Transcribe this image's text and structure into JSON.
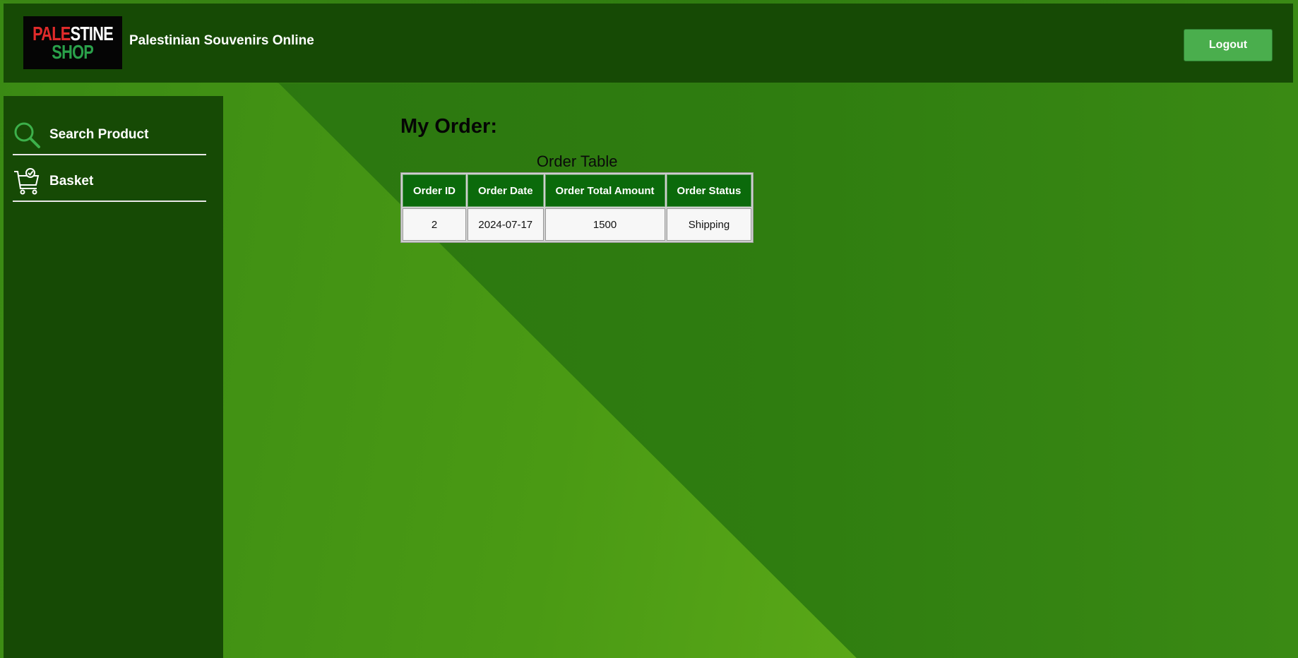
{
  "header": {
    "logo": {
      "line1_red": "PALE",
      "line1_white": "STINE",
      "line2": "SHOP"
    },
    "site_title": "Palestinian Souvenirs Online",
    "logout_label": "Logout"
  },
  "sidebar": {
    "items": [
      {
        "label": "Search Product",
        "icon": "search-icon"
      },
      {
        "label": "Basket",
        "icon": "cart-icon"
      }
    ]
  },
  "main": {
    "heading": "My Order:",
    "table": {
      "caption": "Order Table",
      "columns": [
        "Order ID",
        "Order Date",
        "Order Total Amount",
        "Order Status"
      ],
      "rows": [
        [
          "2",
          "2024-07-17",
          "1500",
          "Shipping"
        ]
      ]
    }
  },
  "colors": {
    "header_bg": "#164a05",
    "sidebar_bg": "#164a05",
    "button_bg": "#4aae4d",
    "table_header_bg": "#0b6a0b"
  }
}
